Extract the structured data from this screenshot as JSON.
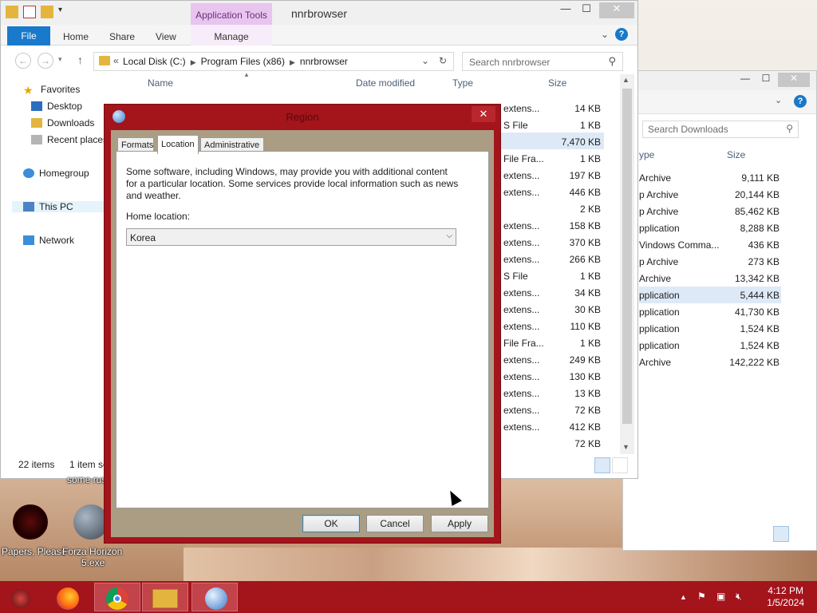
{
  "explorer": {
    "title": "nnrbrowser",
    "app_tools": "Application Tools",
    "ribbon": {
      "file": "File",
      "home": "Home",
      "share": "Share",
      "view": "View",
      "manage": "Manage"
    },
    "path": [
      "Local Disk (C:)",
      "Program Files (x86)",
      "nnrbrowser"
    ],
    "path_prefix": "«",
    "search_placeholder": "Search nnrbrowser",
    "nav": {
      "favorites": "Favorites",
      "desktop": "Desktop",
      "downloads": "Downloads",
      "recent": "Recent places",
      "homegroup": "Homegroup",
      "thispc": "This PC",
      "network": "Network"
    },
    "columns": {
      "name": "Name",
      "date": "Date modified",
      "type": "Type",
      "size": "Size"
    },
    "rows": [
      {
        "type": "extens...",
        "size": "14 KB"
      },
      {
        "type": "S File",
        "size": "1 KB"
      },
      {
        "type": "",
        "size": "7,470 KB"
      },
      {
        "type": "File Fra...",
        "size": "1 KB"
      },
      {
        "type": "extens...",
        "size": "197 KB"
      },
      {
        "type": "extens...",
        "size": "446 KB"
      },
      {
        "type": "",
        "size": "2 KB"
      },
      {
        "type": "extens...",
        "size": "158 KB"
      },
      {
        "type": "extens...",
        "size": "370 KB"
      },
      {
        "type": "extens...",
        "size": "266 KB"
      },
      {
        "type": "S File",
        "size": "1 KB"
      },
      {
        "type": "extens...",
        "size": "34 KB"
      },
      {
        "type": "extens...",
        "size": "30 KB"
      },
      {
        "type": "extens...",
        "size": "110 KB"
      },
      {
        "type": "File Fra...",
        "size": "1 KB"
      },
      {
        "type": "extens...",
        "size": "249 KB"
      },
      {
        "type": "extens...",
        "size": "130 KB"
      },
      {
        "type": "extens...",
        "size": "13 KB"
      },
      {
        "type": "extens...",
        "size": "72 KB"
      },
      {
        "type": "extens...",
        "size": "412 KB"
      },
      {
        "type": "",
        "size": "72 KB"
      }
    ],
    "status_items": "22 items",
    "status_selected": "1 item se"
  },
  "downloads": {
    "search_placeholder": "Search Downloads",
    "col_type": "ype",
    "col_size": "Size",
    "rows": [
      {
        "type": "Archive",
        "size": "9,111 KB"
      },
      {
        "type": "p Archive",
        "size": "20,144 KB"
      },
      {
        "type": "p Archive",
        "size": "85,462 KB"
      },
      {
        "type": "pplication",
        "size": "8,288 KB"
      },
      {
        "type": "Vindows Comma...",
        "size": "436 KB"
      },
      {
        "type": "p Archive",
        "size": "273 KB"
      },
      {
        "type": "Archive",
        "size": "13,342 KB"
      },
      {
        "type": "pplication",
        "size": "5,444 KB"
      },
      {
        "type": "pplication",
        "size": "41,730 KB"
      },
      {
        "type": "pplication",
        "size": "1,524 KB"
      },
      {
        "type": "pplication",
        "size": "1,524 KB"
      },
      {
        "type": "Archive",
        "size": "142,222 KB"
      }
    ]
  },
  "dialog": {
    "title": "Region",
    "tabs": [
      "Formats",
      "Location",
      "Administrative"
    ],
    "description": "Some software, including Windows, may provide you with additional content for a particular location. Some services provide local information such as news and weather.",
    "home_location_label": "Home location:",
    "home_location_value": "Korea",
    "ok": "OK",
    "cancel": "Cancel",
    "apply": "Apply"
  },
  "desktop": {
    "icon1_label": "Papers, Please",
    "icon2_label_line1": "Forza Horizon",
    "icon2_label_line2": "5.exe",
    "partial_label": "some rus"
  },
  "taskbar": {
    "time": "4:12 PM",
    "date": "1/5/2024"
  },
  "colors": {
    "accent": "#a3141b",
    "ribbon_file": "#1979ca"
  }
}
